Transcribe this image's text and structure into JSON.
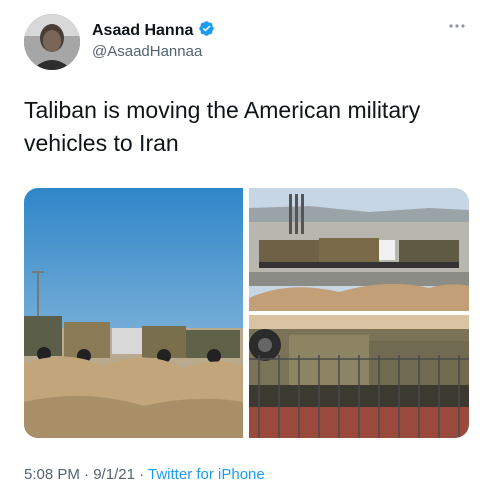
{
  "author": {
    "name": "Asaad Hanna",
    "handle": "@AsaadHannaa",
    "verified": true
  },
  "tweet": {
    "text": "Taliban is moving the American military vehicles to Iran"
  },
  "media": {
    "count": 3,
    "photos": [
      "armored vehicles parked behind dirt mounds",
      "trucks carrying military vehicles on highway",
      "close-up of military vehicles behind metal fence"
    ]
  },
  "footer": {
    "time": "5:08 PM",
    "separator": "·",
    "date": "9/1/21",
    "source": "Twitter for iPhone"
  },
  "colors": {
    "accent": "#1d9bf0",
    "text": "#0f1419",
    "secondary": "#536471"
  },
  "icons": {
    "verified": "verified-badge-icon",
    "more": "more-options-icon"
  }
}
